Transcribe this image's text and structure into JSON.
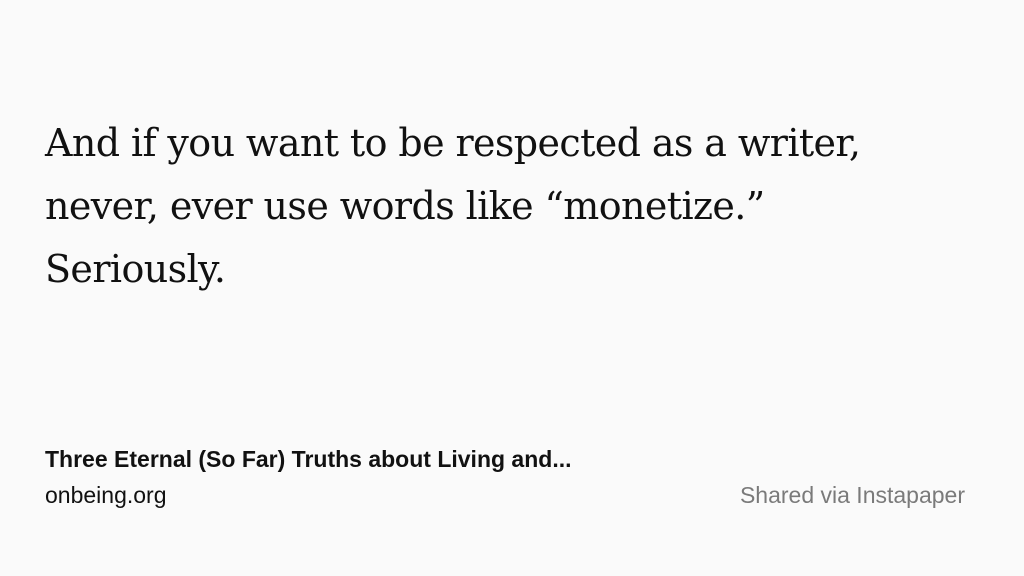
{
  "quote": {
    "lines": [
      "And if you want to be respected as a writer,",
      "never, ever use words like “monetize.”",
      "Seriously."
    ]
  },
  "source": {
    "title": "Three Eternal (So Far) Truths about Living and...",
    "domain": "onbeing.org"
  },
  "share": {
    "label": "Shared via Instapaper"
  },
  "colors": {
    "background": "#fafafa",
    "text": "#111111",
    "muted": "#7a7a7a"
  }
}
